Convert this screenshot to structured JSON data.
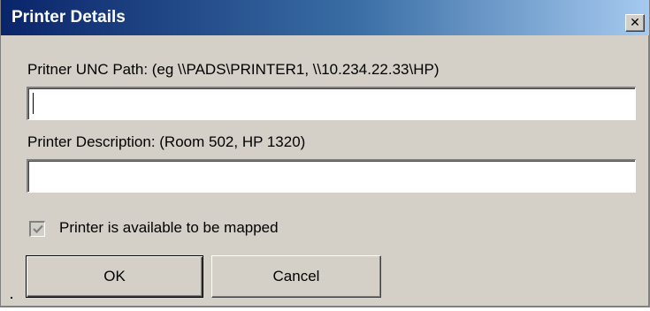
{
  "window": {
    "title": "Printer Details",
    "close_glyph": "✕"
  },
  "unc_path": {
    "label": "Pritner UNC Path: (eg \\\\PADS\\PRINTER1, \\\\10.234.22.33\\HP)",
    "value": ""
  },
  "description": {
    "label": "Printer Description: (Room 502, HP 1320)",
    "value": ""
  },
  "mappable": {
    "label": "Printer is available to be mapped",
    "checked": true,
    "disabled": true
  },
  "buttons": {
    "ok_label": "OK",
    "cancel_label": "Cancel"
  },
  "colors": {
    "title_gradient_start": "#0a246a",
    "title_gradient_end": "#a6caf0",
    "dialog_face": "#d4d0c8"
  }
}
